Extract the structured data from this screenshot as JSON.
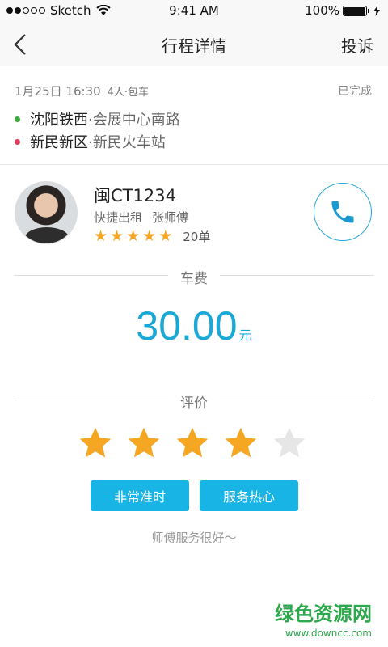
{
  "status_bar": {
    "carrier": "Sketch",
    "time": "9:41 AM",
    "battery": "100%"
  },
  "nav": {
    "title": "行程详情",
    "action": "投诉"
  },
  "trip": {
    "date_time": "1月25日 16:30",
    "sub": "4人·包车",
    "status": "已完成",
    "from": {
      "area": "沈阳铁西",
      "place": "·会展中心南路",
      "color": "#3daa3d"
    },
    "to": {
      "area": "新民新区",
      "place": "·新民火车站",
      "color": "#e23b5b"
    }
  },
  "driver": {
    "plate": "闽CT1234",
    "company": "快捷出租",
    "name": "张师傅",
    "stars": 5,
    "orders": "20单"
  },
  "fare": {
    "section_label": "车费",
    "amount": "30.00",
    "unit": "元"
  },
  "rating": {
    "section_label": "评价",
    "value": 4,
    "max": 5
  },
  "tags": [
    "非常准时",
    "服务热心"
  ],
  "comment": "师傅服务很好～",
  "watermark": {
    "title": "绿色资源网",
    "url": "www.downcc.com"
  },
  "colors": {
    "accent": "#18b4e6",
    "star": "#f5a623",
    "star_off": "#e6e6e6"
  }
}
